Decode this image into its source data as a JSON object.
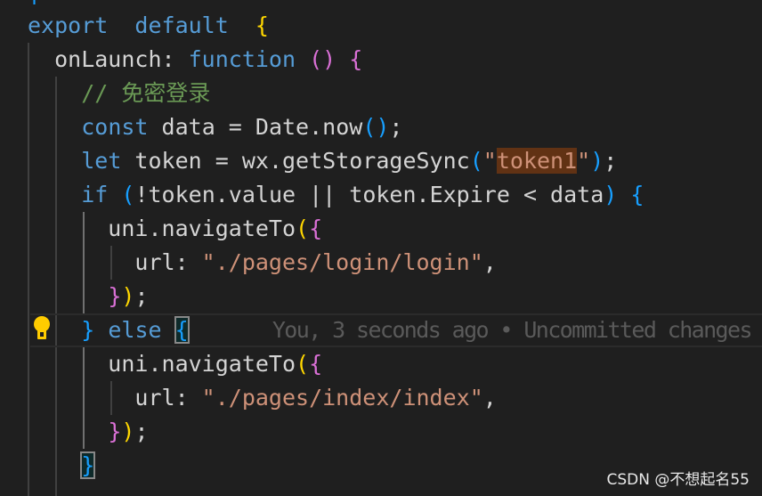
{
  "editor": {
    "lines": [
      {
        "tokens": [
          [
            "b3",
            "|"
          ]
        ]
      },
      {
        "tokens": [
          [
            "kw",
            "export"
          ],
          [
            "",
            "  "
          ],
          [
            "kw",
            "default"
          ],
          [
            "",
            "  "
          ],
          [
            "b1",
            "{"
          ]
        ]
      },
      {
        "tokens": [
          [
            "",
            "  onLaunch: "
          ],
          [
            "kw",
            "function"
          ],
          [
            "",
            " "
          ],
          [
            "b2",
            "()"
          ],
          [
            "",
            " "
          ],
          [
            "b2",
            "{"
          ]
        ]
      },
      {
        "tokens": [
          [
            "cm",
            "    // 免密登录"
          ]
        ]
      },
      {
        "tokens": [
          [
            "",
            "    "
          ],
          [
            "kw",
            "const"
          ],
          [
            "",
            " data = Date.now"
          ],
          [
            "b3",
            "()"
          ],
          [
            "",
            ";"
          ]
        ]
      },
      {
        "tokens": [
          [
            "",
            "    "
          ],
          [
            "kw",
            "let"
          ],
          [
            "",
            " token = wx.getStorageSync"
          ],
          [
            "b3",
            "("
          ],
          [
            "str",
            "\""
          ],
          [
            "str hl",
            "token1"
          ],
          [
            "str",
            "\""
          ],
          [
            "b3",
            ")"
          ],
          [
            "",
            ";"
          ]
        ]
      },
      {
        "tokens": [
          [
            "",
            "    "
          ],
          [
            "kw",
            "if"
          ],
          [
            "",
            " "
          ],
          [
            "b3",
            "("
          ],
          [
            "",
            "!token.value || token.Expire < data"
          ],
          [
            "b3",
            ")"
          ],
          [
            "",
            " "
          ],
          [
            "b3",
            "{"
          ]
        ]
      },
      {
        "tokens": [
          [
            "",
            "      uni.navigateTo"
          ],
          [
            "b1",
            "("
          ],
          [
            "b2",
            "{"
          ]
        ]
      },
      {
        "tokens": [
          [
            "",
            "        url: "
          ],
          [
            "str",
            "\"./pages/login/login\""
          ],
          [
            "",
            ","
          ]
        ]
      },
      {
        "tokens": [
          [
            "",
            "      "
          ],
          [
            "b2",
            "}"
          ],
          [
            "b1",
            ")"
          ],
          [
            "",
            ";"
          ]
        ]
      },
      {
        "tokens": [
          [
            "",
            "    "
          ],
          [
            "b3",
            "}"
          ],
          [
            "",
            " "
          ],
          [
            "kw",
            "else"
          ],
          [
            "",
            " "
          ],
          [
            "b3 box",
            "{"
          ],
          [
            "blame",
            "       You, 3 seconds ago • Uncommitted changes"
          ]
        ]
      },
      {
        "tokens": [
          [
            "",
            "      uni.navigateTo"
          ],
          [
            "b1",
            "("
          ],
          [
            "b2",
            "{"
          ]
        ]
      },
      {
        "tokens": [
          [
            "",
            "        url: "
          ],
          [
            "str",
            "\"./pages/index/index\""
          ],
          [
            "",
            ","
          ]
        ]
      },
      {
        "tokens": [
          [
            "",
            "      "
          ],
          [
            "b2",
            "}"
          ],
          [
            "b1",
            ")"
          ],
          [
            "",
            ";"
          ]
        ]
      },
      {
        "tokens": [
          [
            "",
            "    "
          ],
          [
            "b3 box",
            "}"
          ]
        ]
      }
    ],
    "lightbulb_icon": "lightbulb-icon",
    "lightbulb_color": "#ffcc00"
  },
  "watermark": "CSDN @不想起名55"
}
